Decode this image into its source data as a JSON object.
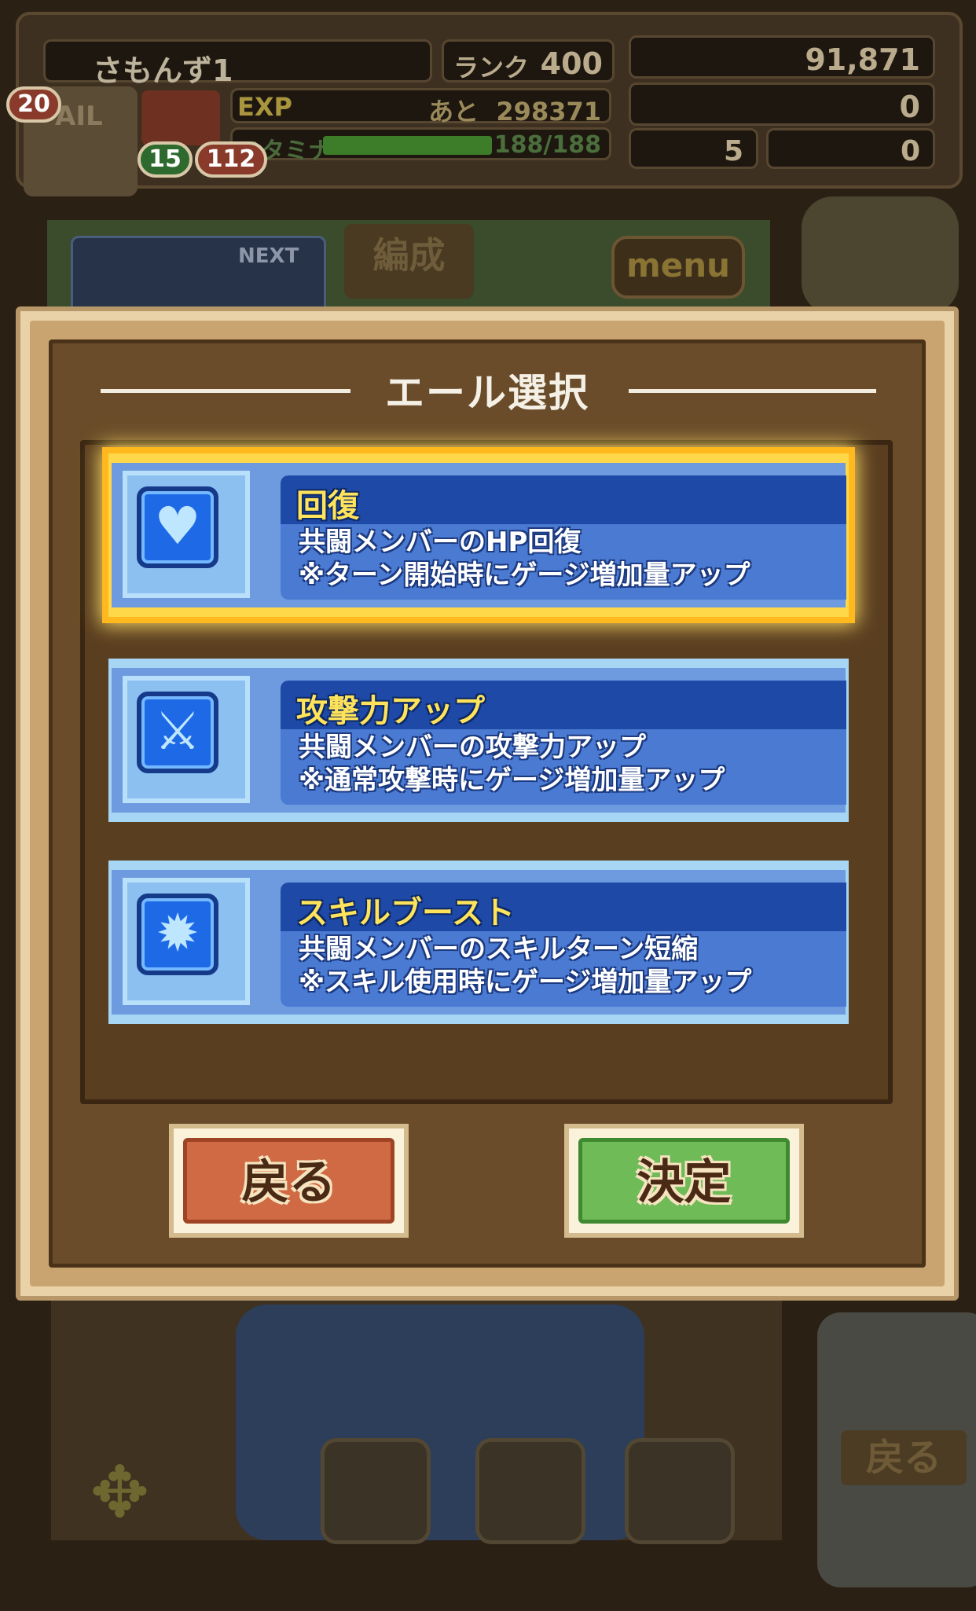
{
  "hud": {
    "player_name": "さもんず1",
    "rank_label": "ランク",
    "rank_value": "400",
    "coins": "91,871",
    "gems": "0",
    "crystals": "5",
    "tickets": "0",
    "exp_label": "EXP",
    "exp_remaining_label": "あと",
    "exp_remaining": "298371",
    "stamina_label": "スタミナ",
    "stamina": "188/188",
    "mail_badge": "20",
    "gift_badge_green": "15",
    "gift_badge_red": "112",
    "mail_label": "AIL"
  },
  "map": {
    "next_label": "NEXT",
    "hensei_tab": "編成",
    "menu_button": "menu",
    "side_back_label": "戻る",
    "dpad_icon": "✥"
  },
  "dialog": {
    "title": "エール選択",
    "options": [
      {
        "title": "回復",
        "desc1": "共闘メンバーのHP回復",
        "desc2": "※ターン開始時にゲージ増加量アップ",
        "icon": "heart-target-icon",
        "glyph": "♥",
        "selected": true
      },
      {
        "title": "攻撃力アップ",
        "desc1": "共闘メンバーの攻撃力アップ",
        "desc2": "※通常攻撃時にゲージ増加量アップ",
        "icon": "sword-icon",
        "glyph": "⚔",
        "selected": false
      },
      {
        "title": "スキルブースト",
        "desc1": "共闘メンバーのスキルターン短縮",
        "desc2": "※スキル使用時にゲージ増加量アップ",
        "icon": "sun-boost-icon",
        "glyph": "✹",
        "selected": false
      }
    ],
    "back_button": "戻る",
    "confirm_button": "決定"
  },
  "colors": {
    "selected_glow": "#ffb81e",
    "card_blue": "#6e9be0",
    "title_yellow": "#ffe35a",
    "back_red": "#d06a44",
    "confirm_green": "#6fbb58"
  }
}
